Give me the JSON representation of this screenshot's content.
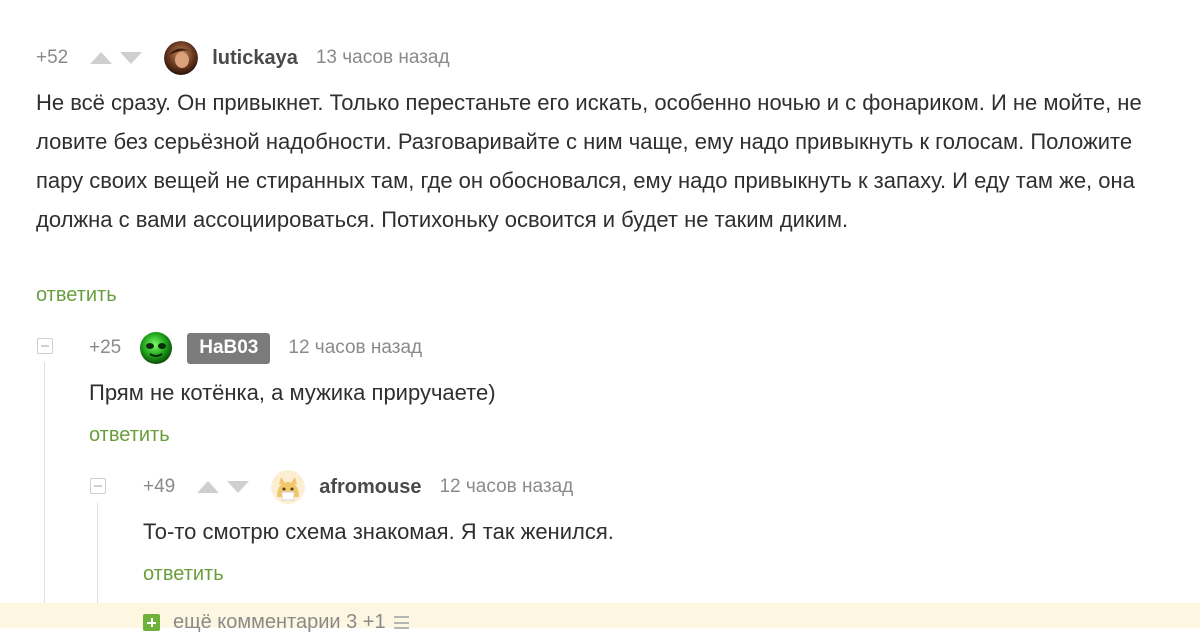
{
  "comments": [
    {
      "rating": "+52",
      "username": "lutickaya",
      "time": "13 часов назад",
      "text": "Не всё сразу. Он привыкнет. Только перестаньте его искать, особенно ночью и с фонариком. И не мойте, не ловите без серьёзной надобности. Разговаривайте с ним чаще, ему надо привыкнуть к голосам. Положите пару своих вещей не стиранных там, где он обосновался, ему надо привыкнуть к запаху. И еду там же, она должна с вами ассоциироваться. Потихоньку освоится и будет не таким диким.",
      "reply": "ответить",
      "avatar_icon": "user-avatar-icon"
    },
    {
      "rating": "+25",
      "username": "HaB03",
      "time": "12 часов назад",
      "text": "Прям не котёнка, а мужика приручаете)",
      "reply": "ответить",
      "avatar_icon": "green-alien-avatar-icon"
    },
    {
      "rating": "+49",
      "username": "afromouse",
      "time": "12 часов назад",
      "text": "То-то смотрю схема знакомая. Я так женился.",
      "reply": "ответить",
      "avatar_icon": "cat-avatar-icon"
    }
  ],
  "more_comments": {
    "label": "ещё комментарии 3 +1"
  },
  "colors": {
    "reply_green": "#6a9e3c",
    "meta_gray": "#8a8a8a",
    "badge_gray": "#7b7b7b",
    "more_bar_bg": "#fdf7e2"
  }
}
